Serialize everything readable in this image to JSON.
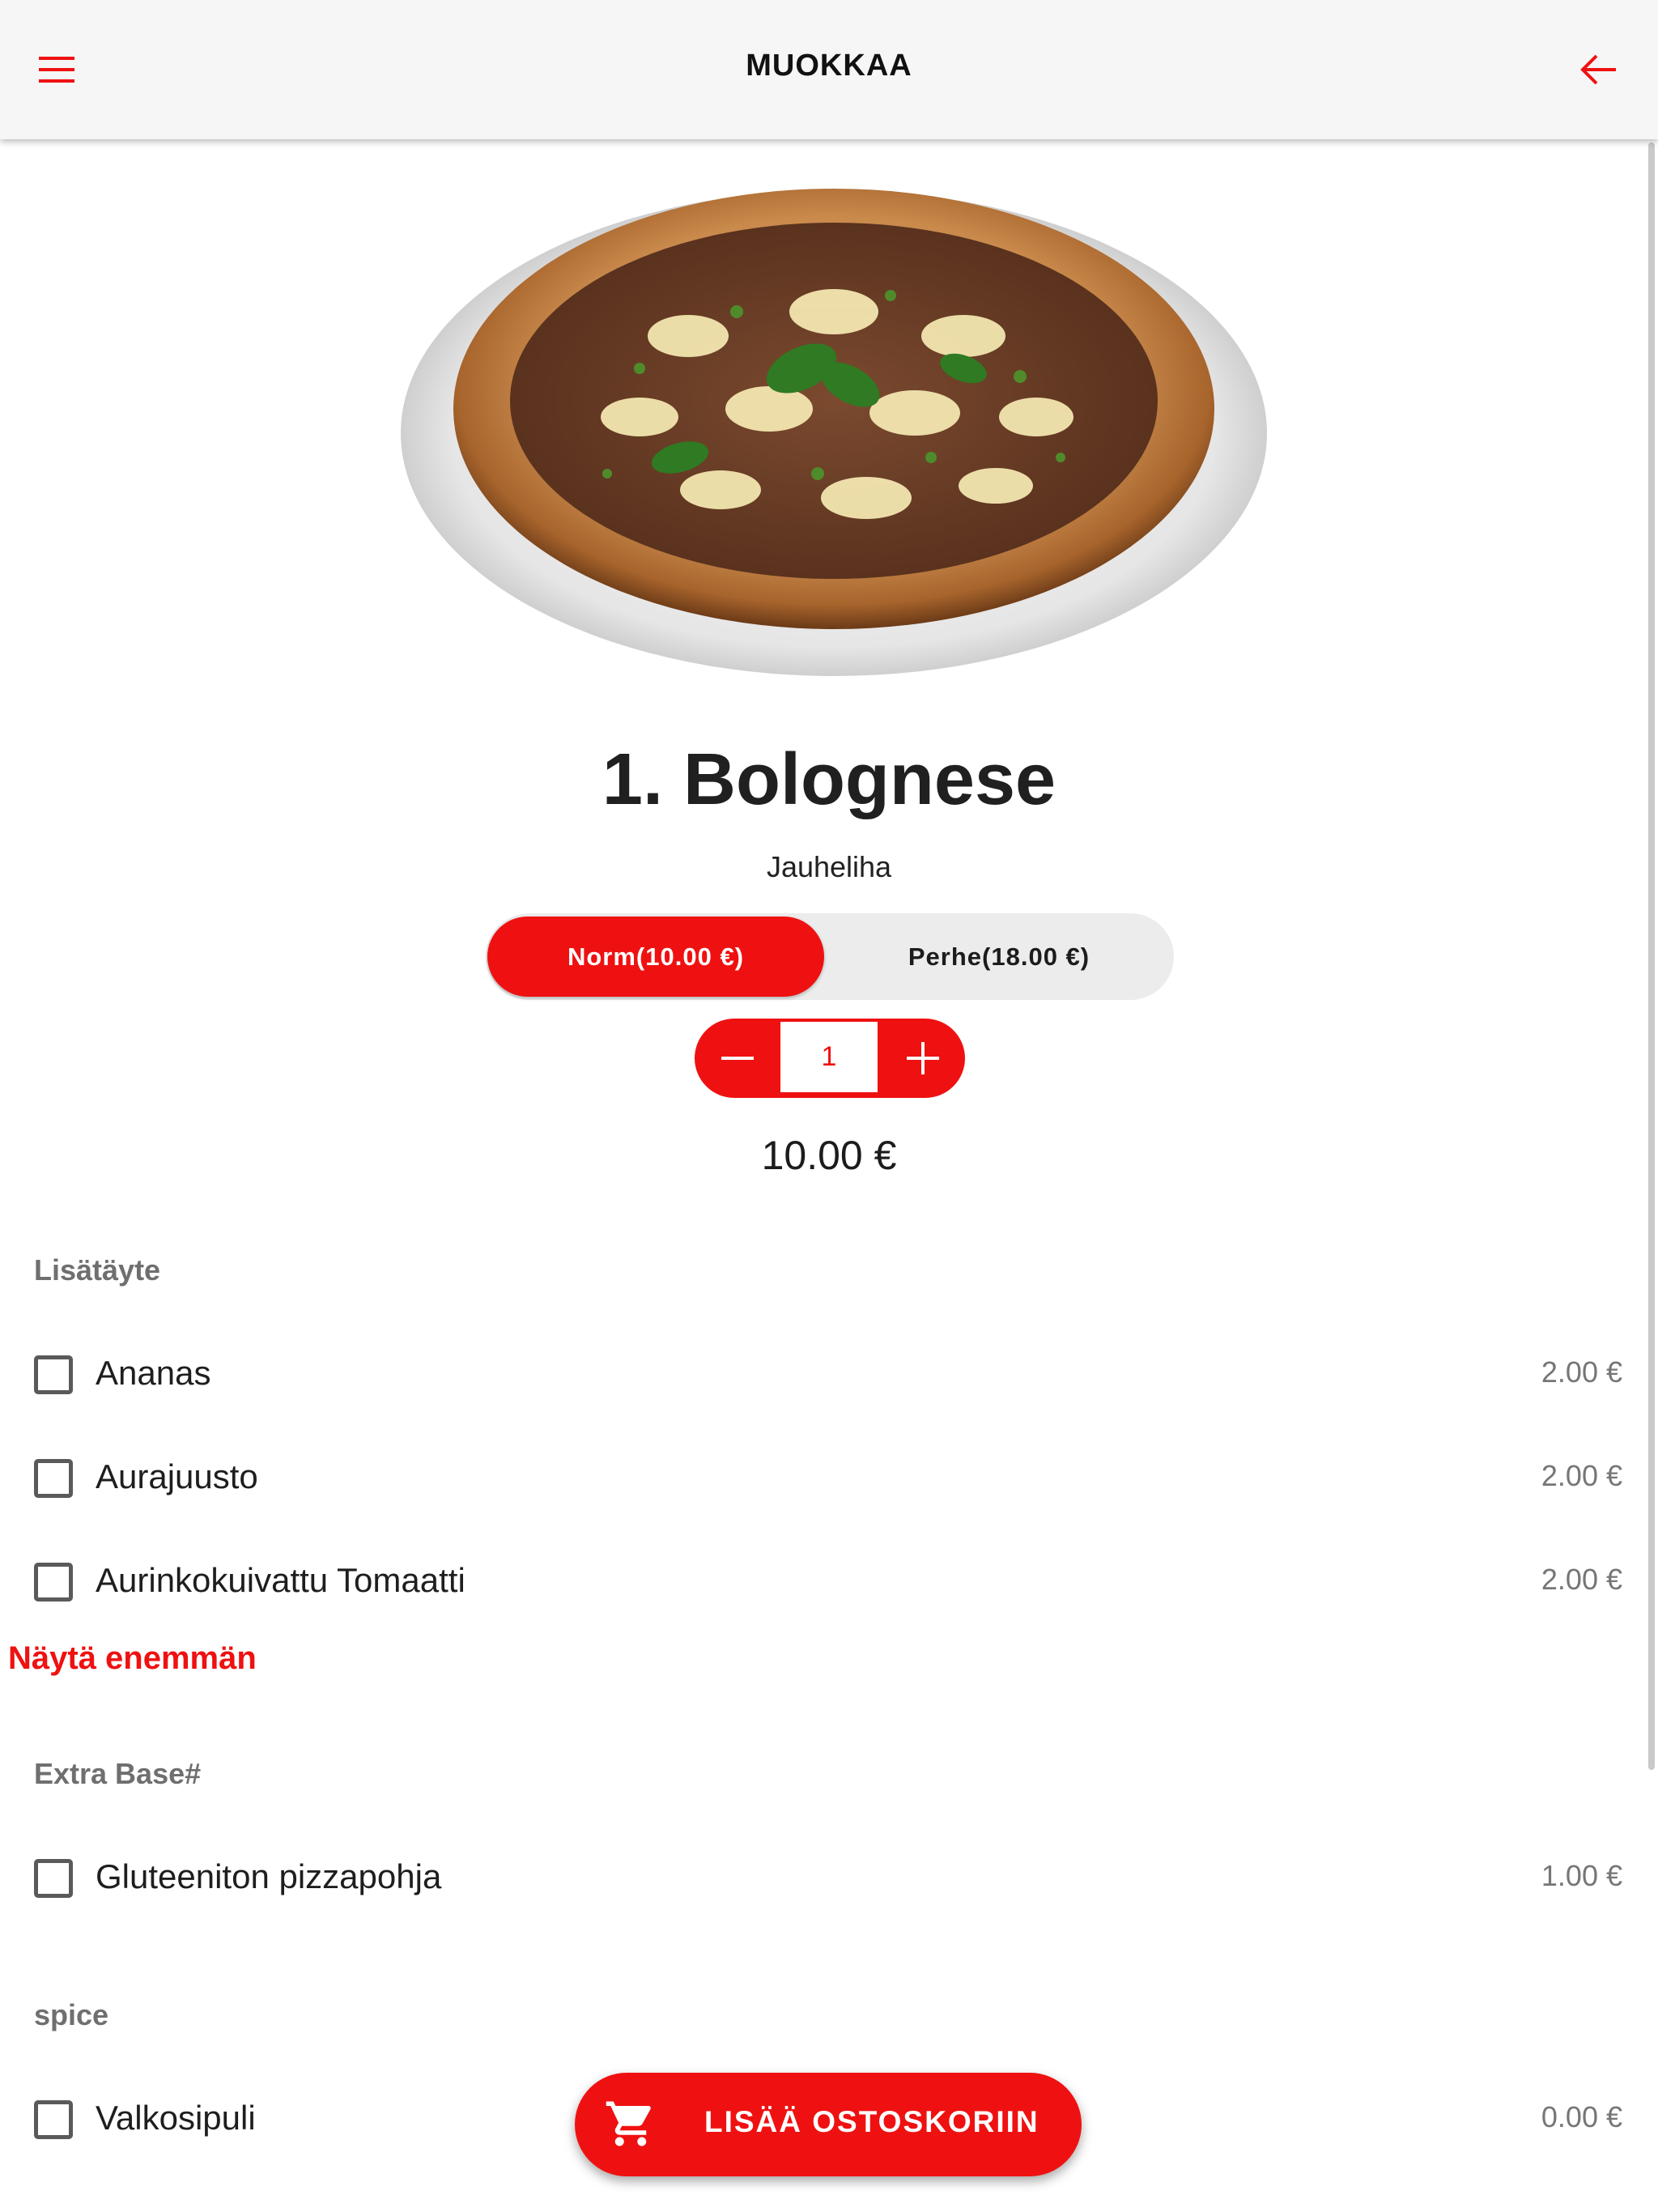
{
  "appbar": {
    "title": "MUOKKAA",
    "menu_icon": "hamburger-menu-icon",
    "back_icon": "arrow-left-icon"
  },
  "colors": {
    "accent": "#ef1111",
    "appbar_bg": "#f6f6f6",
    "muted_text": "#6f6f6f"
  },
  "product": {
    "image_icon": "pizza-photo",
    "title": "1. Bolognese",
    "description": "Jauheliha",
    "sizes": [
      {
        "label": "Norm(10.00 €)",
        "selected": true
      },
      {
        "label": "Perhe(18.00 €)",
        "selected": false
      }
    ],
    "quantity": "1",
    "total": "10.00 €"
  },
  "groups": [
    {
      "title": "Lisätäyte",
      "options": [
        {
          "name": "Ananas",
          "price": "2.00 €",
          "checked": false
        },
        {
          "name": "Aurajuusto",
          "price": "2.00 €",
          "checked": false
        },
        {
          "name": "Aurinkokuivattu Tomaatti",
          "price": "2.00 €",
          "checked": false
        }
      ],
      "show_more": "Näytä enemmän"
    },
    {
      "title": "Extra Base#",
      "options": [
        {
          "name": "Gluteeniton pizzapohja",
          "price": "1.00 €",
          "checked": false
        }
      ]
    },
    {
      "title": "spice",
      "options": [
        {
          "name": "Valkosipuli",
          "price": "0.00 €",
          "checked": false
        }
      ]
    }
  ],
  "cart_button": {
    "label": "LISÄÄ OSTOSKORIIN",
    "icon": "shopping-cart-icon"
  }
}
